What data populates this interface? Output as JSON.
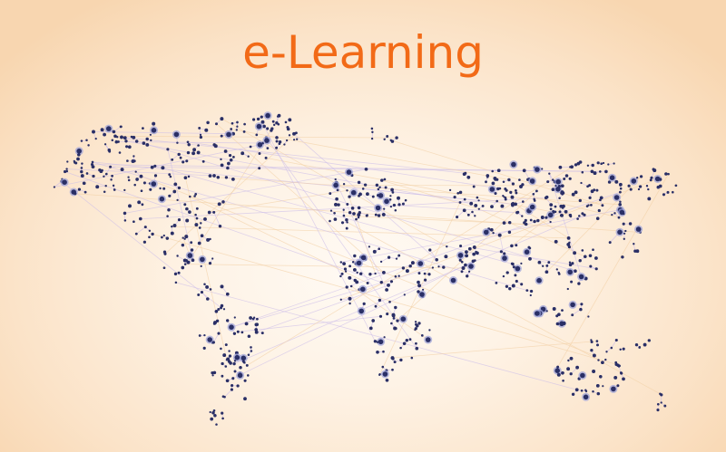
{
  "title": "e-Learning",
  "colors": {
    "title": "#f26a17",
    "node": "#2a2f66",
    "node_ring": "#9aa0d8",
    "link_warm": "#f2cfa3",
    "link_cool": "#cbbce9"
  },
  "illustration": "world-map-network"
}
